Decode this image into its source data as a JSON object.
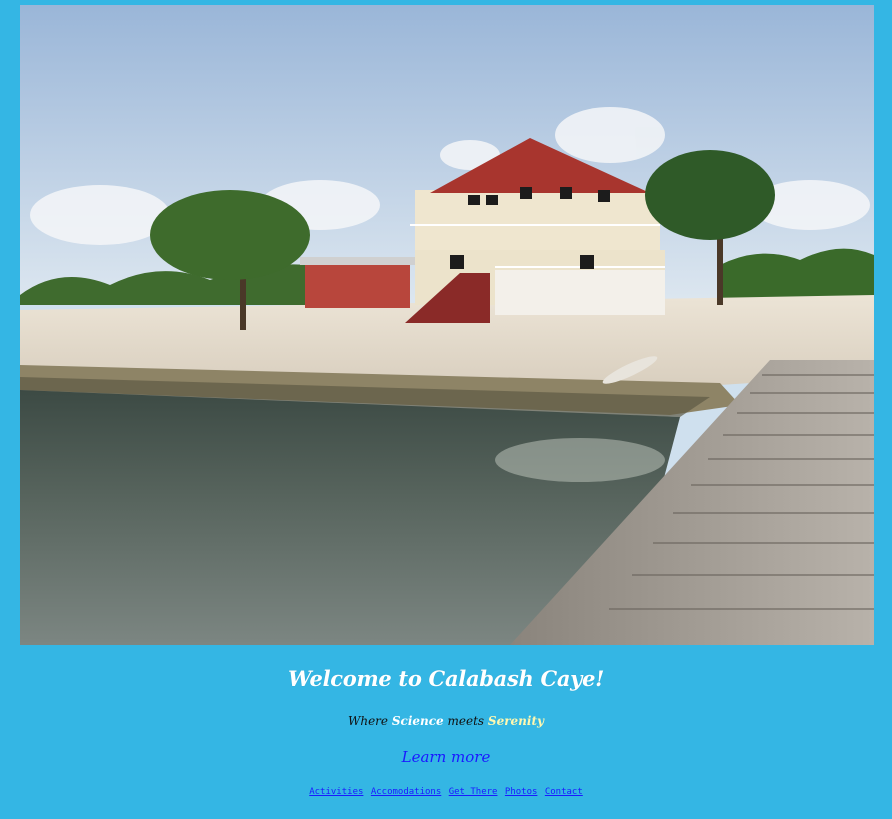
{
  "hero": {
    "image_alt": "Calabash Caye field station with dock and lagoon"
  },
  "title": "Welcome to Calabash Caye!",
  "tagline": {
    "prefix": "Where",
    "word1": "Science",
    "middle": "meets",
    "word2": "Serenity"
  },
  "learn_more": "Learn more",
  "nav": [
    {
      "label": "Activities"
    },
    {
      "label": "Accomodations"
    },
    {
      "label": "Get There"
    },
    {
      "label": "Photos"
    },
    {
      "label": "Contact"
    }
  ],
  "colors": {
    "page_background": "#34b6e4",
    "link": "#1a1aff",
    "title": "#ffffff"
  }
}
